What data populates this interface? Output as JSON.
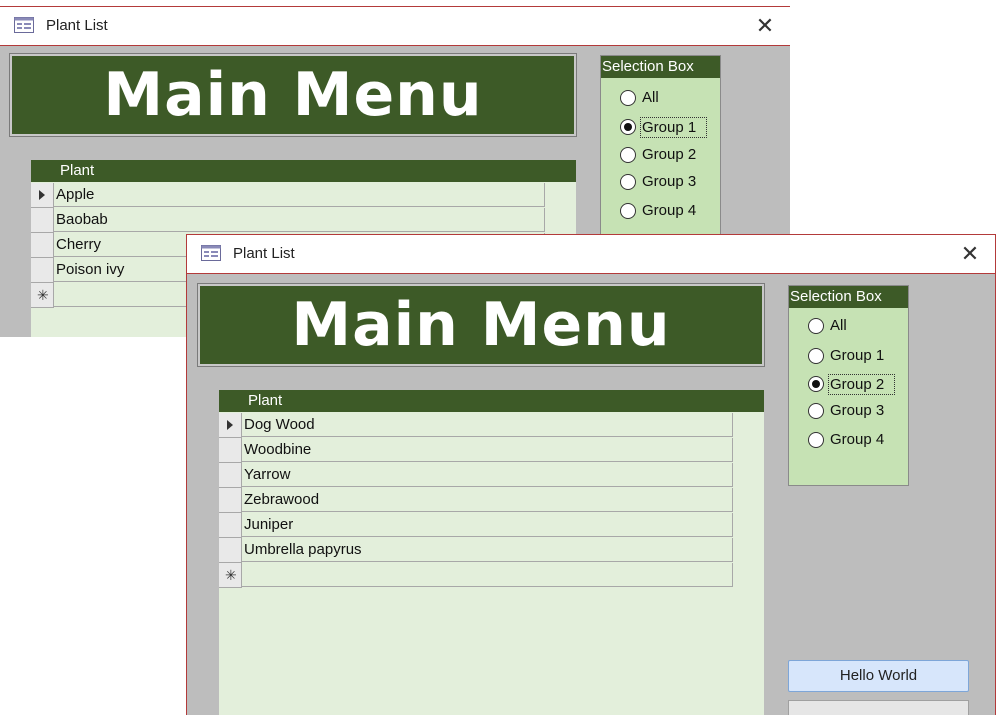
{
  "window_back": {
    "title": "Plant List",
    "header": "Main Menu",
    "grid_header": "Plant",
    "rows": [
      "Apple",
      "Baobab",
      "Cherry",
      "Poison ivy"
    ],
    "selection_box": {
      "title": "Selection Box",
      "options": [
        "All",
        "Group 1",
        "Group 2",
        "Group 3",
        "Group 4"
      ],
      "selected": "Group 1"
    }
  },
  "window_front": {
    "title": "Plant List",
    "header": "Main Menu",
    "grid_header": "Plant",
    "rows": [
      "Dog Wood",
      "Woodbine",
      "Yarrow",
      "Zebrawood",
      "Juniper",
      "Umbrella papyrus"
    ],
    "selection_box": {
      "title": "Selection Box",
      "options": [
        "All",
        "Group 1",
        "Group 2",
        "Group 3",
        "Group 4"
      ],
      "selected": "Group 2"
    },
    "button_label": "Hello World"
  },
  "colors": {
    "header_green": "#3d5a27",
    "grid_background": "#e3efdb",
    "selection_background": "#c6e2b4",
    "form_background": "#bdbdbd",
    "window_border": "#b33a3a"
  },
  "icons": [
    "form-icon",
    "close-icon",
    "record-selector-arrow-icon",
    "new-record-star-icon"
  ]
}
